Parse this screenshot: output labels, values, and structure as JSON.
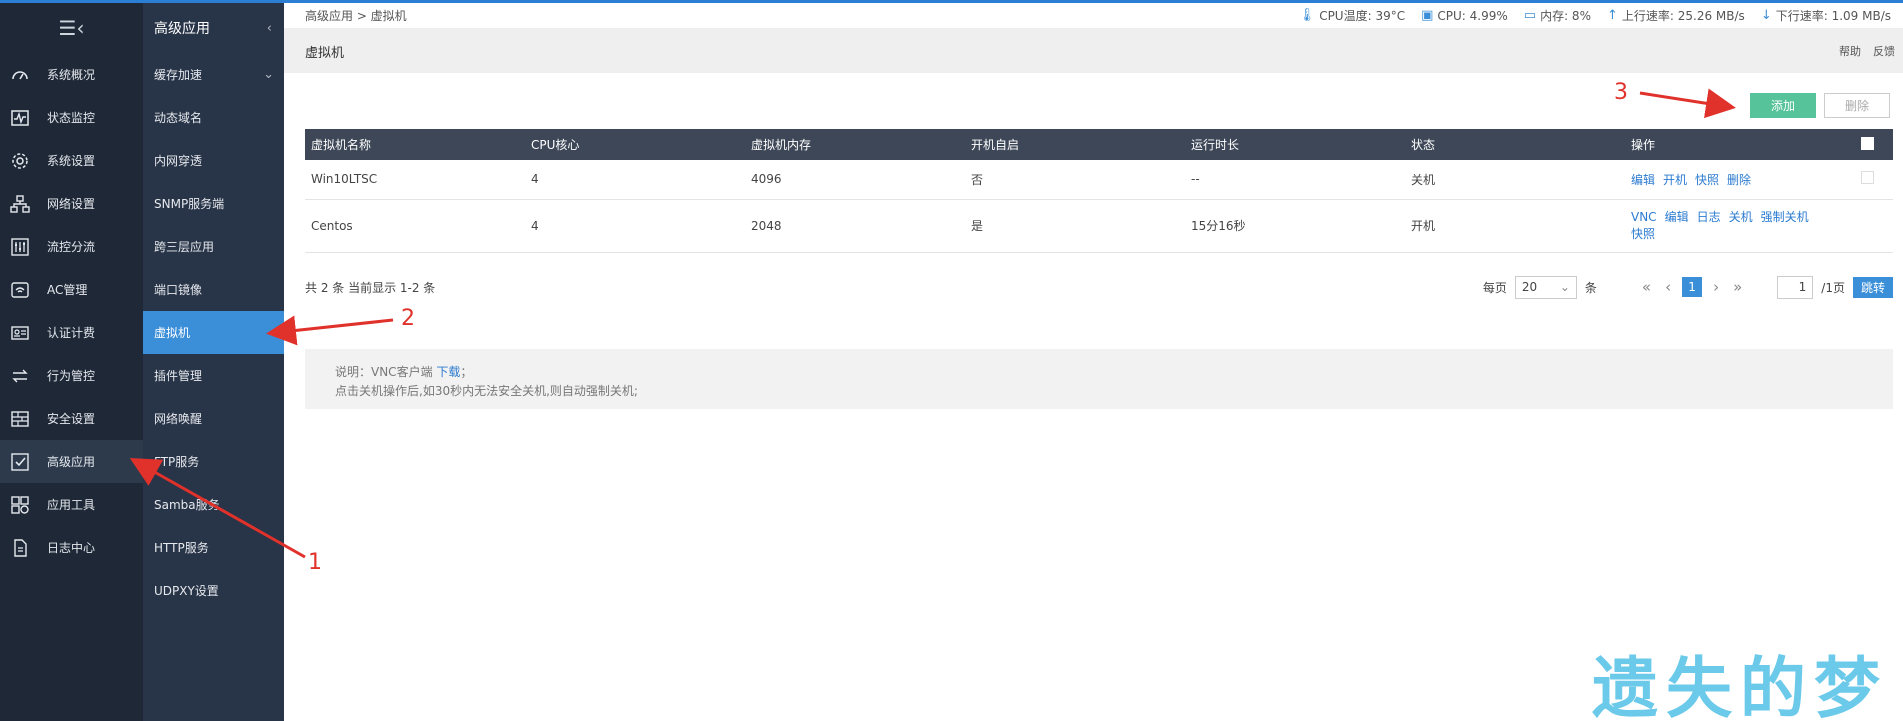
{
  "rail": {
    "items": [
      {
        "label": "系统概况",
        "icon": "dashboard-icon"
      },
      {
        "label": "状态监控",
        "icon": "monitor-icon"
      },
      {
        "label": "系统设置",
        "icon": "gear-icon"
      },
      {
        "label": "网络设置",
        "icon": "network-icon"
      },
      {
        "label": "流控分流",
        "icon": "sliders-icon"
      },
      {
        "label": "AC管理",
        "icon": "wifi-icon"
      },
      {
        "label": "认证计费",
        "icon": "id-card-icon"
      },
      {
        "label": "行为管控",
        "icon": "arrows-icon"
      },
      {
        "label": "安全设置",
        "icon": "firewall-icon"
      },
      {
        "label": "高级应用",
        "icon": "checkbox-icon",
        "active": true
      },
      {
        "label": "应用工具",
        "icon": "tools-icon"
      },
      {
        "label": "日志中心",
        "icon": "log-icon"
      }
    ]
  },
  "submenu": {
    "title": "高级应用",
    "items": [
      {
        "label": "缓存加速",
        "expandable": true
      },
      {
        "label": "动态域名"
      },
      {
        "label": "内网穿透"
      },
      {
        "label": "SNMP服务端"
      },
      {
        "label": "跨三层应用"
      },
      {
        "label": "端口镜像"
      },
      {
        "label": "虚拟机",
        "active": true
      },
      {
        "label": "插件管理"
      },
      {
        "label": "网络唤醒"
      },
      {
        "label": "FTP服务"
      },
      {
        "label": "Samba服务"
      },
      {
        "label": "HTTP服务"
      },
      {
        "label": "UDPXY设置"
      }
    ]
  },
  "status": {
    "breadcrumb": "高级应用 > 虚拟机",
    "cpu_temp": "CPU温度: 39°C",
    "cpu": "CPU: 4.99%",
    "mem": "内存: 8%",
    "up": "上行速率: 25.26 MB/s",
    "down": "下行速率: 1.09 MB/s"
  },
  "page": {
    "title": "虚拟机",
    "help": "帮助",
    "feedback": "反馈"
  },
  "toolbar": {
    "add": "添加",
    "delete": "删除"
  },
  "table": {
    "headers": [
      "虚拟机名称",
      "CPU核心",
      "虚拟机内存",
      "开机自启",
      "运行时长",
      "状态",
      "操作"
    ],
    "rows": [
      {
        "name": "Win10LTSC",
        "cpu": "4",
        "mem": "4096",
        "autostart": "否",
        "uptime": "--",
        "status": "关机",
        "ops": [
          "编辑",
          "开机",
          "快照",
          "删除"
        ]
      },
      {
        "name": "Centos",
        "cpu": "4",
        "mem": "2048",
        "autostart": "是",
        "uptime": "15分16秒",
        "status": "开机",
        "ops": [
          "VNC",
          "编辑",
          "日志",
          "关机",
          "强制关机",
          "快照"
        ]
      }
    ]
  },
  "pager": {
    "summary": "共 2 条 当前显示 1-2 条",
    "per_page_label": "每页",
    "per_page": "20",
    "unit": "条",
    "current": "1",
    "page_input": "1",
    "total_pages": "/1页",
    "jump": "跳转"
  },
  "note": {
    "prefix": "说明：VNC客户端",
    "download": "下载",
    "suffix": "；",
    "line2": "点击关机操作后,如30秒内无法安全关机,则自动强制关机;"
  },
  "annotations": {
    "n1": "1",
    "n2": "2",
    "n3": "3"
  },
  "watermark": "遗失的梦",
  "colors": {
    "accent": "#3b8fd8",
    "add": "#56c39a",
    "off": "#e55a4e",
    "on": "#4cb884",
    "annotation": "#e0312b"
  }
}
